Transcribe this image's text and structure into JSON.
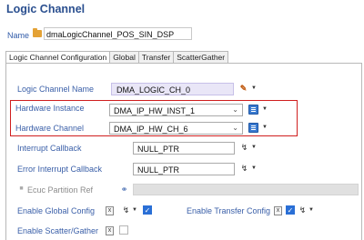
{
  "title": "Logic Channel",
  "name_row": {
    "label": "Name",
    "value": "dmaLogicChannel_POS_SIN_DSP"
  },
  "tabs": [
    {
      "label": "Logic Channel Configuration",
      "active": true
    },
    {
      "label": "Global",
      "active": false
    },
    {
      "label": "Transfer",
      "active": false
    },
    {
      "label": "ScatterGather",
      "active": false
    }
  ],
  "fields": {
    "logic_channel_name": {
      "label": "Logic Channel Name",
      "value": "DMA_LOGIC_CH_0"
    },
    "hardware_instance": {
      "label": "Hardware Instance",
      "value": "DMA_IP_HW_INST_1"
    },
    "hardware_channel": {
      "label": "Hardware Channel",
      "value": "DMA_IP_HW_CH_6"
    },
    "interrupt_callback": {
      "label": "Interrupt Callback",
      "value": "NULL_PTR"
    },
    "error_interrupt_callback": {
      "label": "Error Interrupt Callback",
      "value": "NULL_PTR"
    },
    "ecuc_partition_ref": {
      "label": "Ecuc Partition Ref"
    },
    "enable_global_config": {
      "label": "Enable Global Config",
      "checked": true
    },
    "enable_transfer_config": {
      "label": "Enable Transfer Config",
      "checked": true
    },
    "enable_scatter_gather": {
      "label": "Enable Scatter/Gather",
      "checked": false
    }
  },
  "glyphs": {
    "chevron": "⌄",
    "caret": "▼",
    "check": "✓",
    "x": "x",
    "pencil": "✎",
    "lightning": "↯",
    "link": "⚭"
  },
  "colors": {
    "title": "#2a4f8f",
    "label": "#3a5fa8",
    "highlight_border": "#d01e1e",
    "checkbox": "#2a6fd6"
  }
}
